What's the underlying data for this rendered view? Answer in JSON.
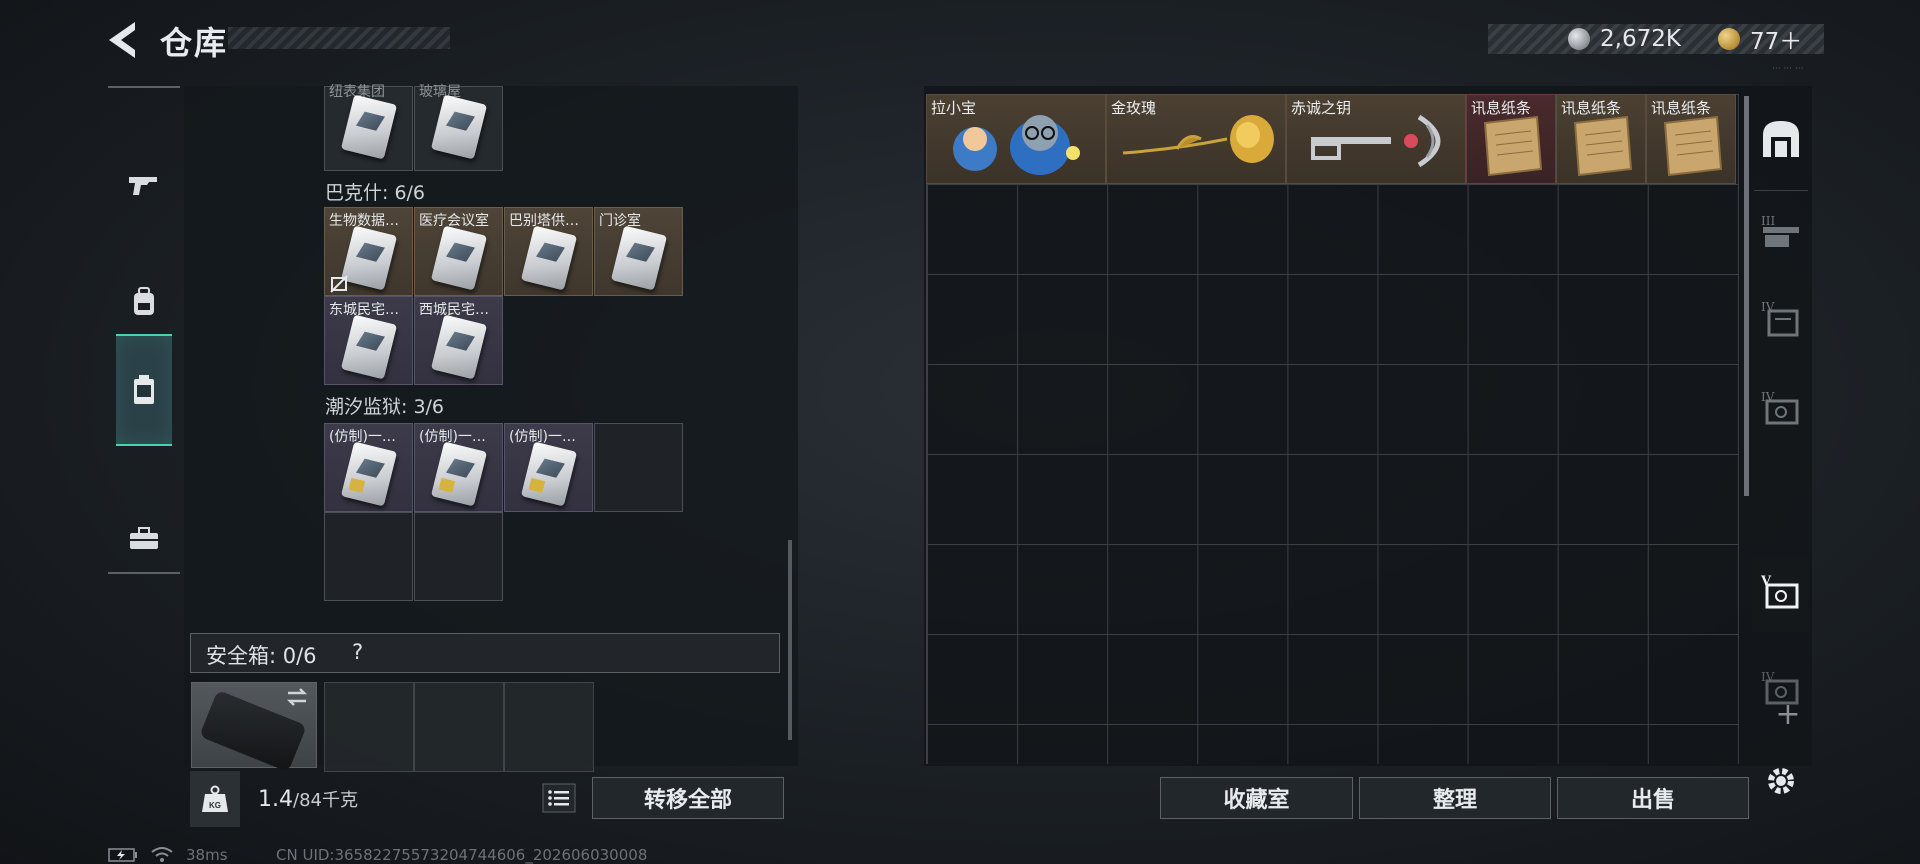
{
  "header": {
    "title": "仓库",
    "currency": [
      {
        "icon": "silver-coin-icon",
        "value": "2,672K"
      },
      {
        "icon": "gold-coin-icon",
        "value": "77＋"
      }
    ],
    "tiny_text": "··· ··· ···"
  },
  "left_rail": {
    "items": [
      {
        "name": "weapons",
        "icon": "gun-icon",
        "active": false
      },
      {
        "name": "gear",
        "icon": "backpack-icon",
        "active": false
      },
      {
        "name": "keys",
        "icon": "keycard-case-icon",
        "active": true
      },
      {
        "name": "toolbox",
        "icon": "toolbox-icon",
        "active": false
      }
    ]
  },
  "left_panel": {
    "top_cut_labels": [
      "纽表集团",
      "玻璃屋"
    ],
    "sections": [
      {
        "title": "巴克什: 6/6",
        "items": [
          {
            "label": "生物数据…",
            "style": "brown",
            "locked": true
          },
          {
            "label": "医疗会议室",
            "style": "brown"
          },
          {
            "label": "巴别塔供…",
            "style": "brown"
          },
          {
            "label": "门诊室",
            "style": "brown"
          },
          {
            "label": "东城民宅…",
            "style": "purple"
          },
          {
            "label": "西城民宅…",
            "style": "purple"
          }
        ]
      },
      {
        "title": "潮汐监狱: 3/6",
        "items": [
          {
            "label": "(仿制)一…",
            "style": "purple"
          },
          {
            "label": "(仿制)一…",
            "style": "purple"
          },
          {
            "label": "(仿制)一…",
            "style": "purple"
          }
        ]
      }
    ],
    "safebox": {
      "label": "安全箱: 0/6",
      "help": "?"
    },
    "weight": {
      "current": "1.4",
      "max": "/84千克"
    },
    "transfer_all": "转移全部"
  },
  "right_panel": {
    "items": [
      {
        "label": "拉小宝",
        "span": 2,
        "style": "brown",
        "icon": "mascot-figure-icon"
      },
      {
        "label": "金玫瑰",
        "span": 2,
        "style": "brown",
        "icon": "golden-rose-icon"
      },
      {
        "label": "赤诚之钥",
        "span": 2,
        "style": "brown",
        "icon": "ornate-key-icon"
      },
      {
        "label": "讯息纸条",
        "span": 1,
        "style": "red",
        "icon": "paper-note-icon"
      },
      {
        "label": "讯息纸条",
        "span": 1,
        "style": "brown",
        "icon": "paper-note-icon"
      },
      {
        "label": "讯息纸条",
        "span": 1,
        "style": "brown",
        "icon": "paper-note-icon"
      }
    ],
    "buttons": {
      "collection": "收藏室",
      "organize": "整理",
      "sell": "出售"
    }
  },
  "right_rail": {
    "items": [
      {
        "label": "",
        "icon": "vault-icon"
      },
      {
        "label": "III",
        "icon": "shelf-iii-icon"
      },
      {
        "label": "IV",
        "icon": "shelf-iv-icon"
      },
      {
        "label": "IV",
        "icon": "safe-iv-icon"
      },
      {
        "label": "V",
        "icon": "safe-v-icon",
        "active": true
      },
      {
        "label": "IV",
        "icon": "safe-iv-icon"
      },
      {
        "label": "+",
        "icon": "plus-icon"
      },
      {
        "label": "",
        "icon": "gear-icon"
      }
    ]
  },
  "status_bar": {
    "ping": "38ms",
    "uid": "CN UID:36582275573204744606_202606030008"
  }
}
